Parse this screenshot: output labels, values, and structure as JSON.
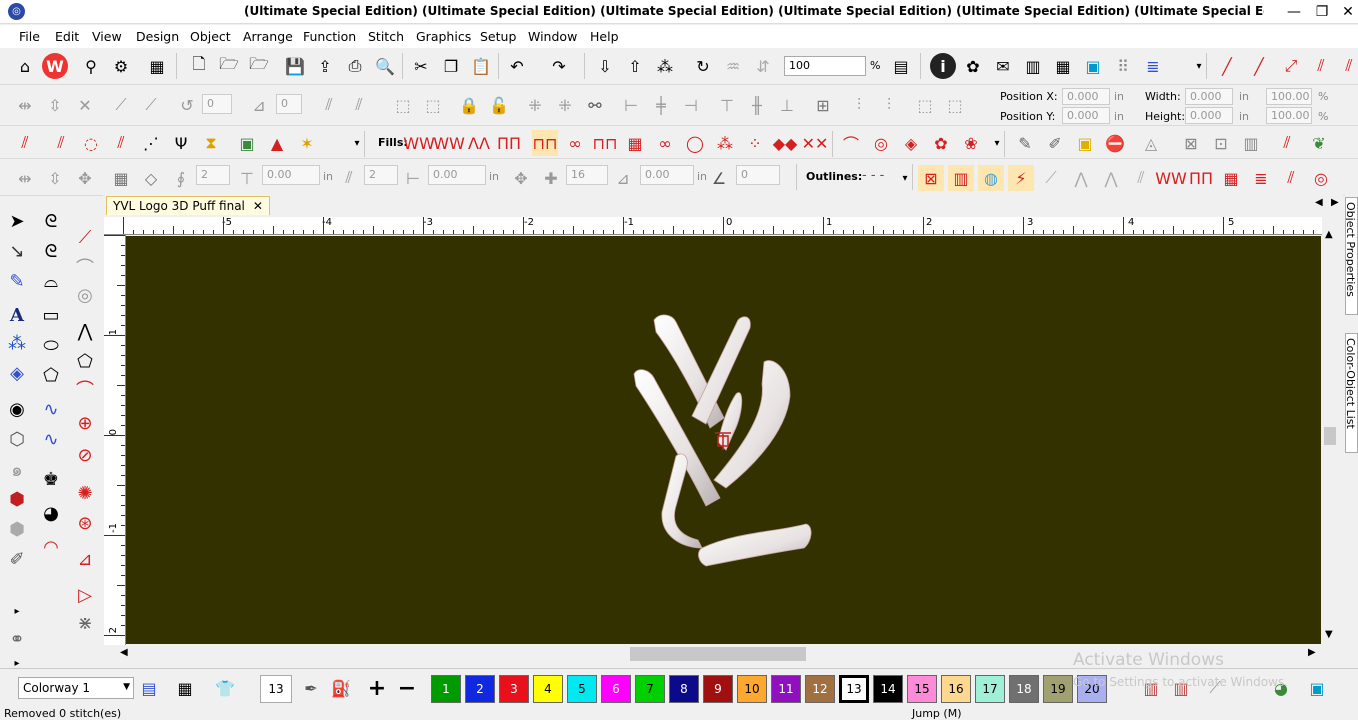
{
  "window": {
    "title": "(Ultimate Special Edition) (Ultimate Special Edition) (Ultimate Special Edition) (Ultimate Special Edition) (Ultimate Special Edition) (Ultimate Special Editi",
    "minimize": "—",
    "restore": "❐",
    "close": "✕"
  },
  "menu": [
    "File",
    "Edit",
    "View",
    "Design",
    "Object",
    "Arrange",
    "Function",
    "Stitch",
    "Graphics",
    "Setup",
    "Window",
    "Help"
  ],
  "toolbar1": {
    "zoom_value": "100",
    "zoom_unit": "%"
  },
  "toolbar2": {
    "rotate_value": "0",
    "slant_value": "0",
    "position_x_label": "Position X:",
    "position_y_label": "Position Y:",
    "position_x": "0.000",
    "position_y": "0.000",
    "pos_unit": "in",
    "width_label": "Width:",
    "height_label": "Height:",
    "width": "0.000",
    "height": "0.000",
    "size_unit": "in",
    "width_pct": "100.00",
    "height_pct": "100.00",
    "pct_unit": "%"
  },
  "toolbar3": {
    "fills_label": "Fills:"
  },
  "toolbar4": {
    "val1": "2",
    "val2": "0.00",
    "unit_in": "in",
    "val3": "2",
    "val4": "0.00",
    "val5": "16",
    "val6": "0.00",
    "val7": "0",
    "outlines_label": "Outlines:"
  },
  "document": {
    "tab_name": "YVL Logo 3D Puff final",
    "tab_close": "✕"
  },
  "ruler": {
    "h_labels": [
      "-5",
      "-4",
      "-3",
      "-2",
      "-1",
      "0",
      "1",
      "2",
      "3",
      "4",
      "5"
    ],
    "v_labels": [
      "-1",
      "0",
      "1",
      "2"
    ]
  },
  "right_panel": {
    "tab1": "Object Properties",
    "tab2": "Color-Object List"
  },
  "colorbar": {
    "colorway": "Colorway 1",
    "current_color": "13",
    "swatches": [
      {
        "n": "1",
        "c": "#009b00",
        "t": "#fff"
      },
      {
        "n": "2",
        "c": "#1028e0",
        "t": "#fff"
      },
      {
        "n": "3",
        "c": "#e8101a",
        "t": "#fff"
      },
      {
        "n": "4",
        "c": "#ffff00",
        "t": "#000"
      },
      {
        "n": "5",
        "c": "#00e8f0",
        "t": "#000"
      },
      {
        "n": "6",
        "c": "#ff00ff",
        "t": "#fff"
      },
      {
        "n": "7",
        "c": "#00d000",
        "t": "#000"
      },
      {
        "n": "8",
        "c": "#0a0a8a",
        "t": "#fff"
      },
      {
        "n": "9",
        "c": "#a01010",
        "t": "#fff"
      },
      {
        "n": "10",
        "c": "#ffa830",
        "t": "#000"
      },
      {
        "n": "11",
        "c": "#9010c0",
        "t": "#fff"
      },
      {
        "n": "12",
        "c": "#a07040",
        "t": "#fff"
      },
      {
        "n": "13",
        "c": "#ffffff",
        "t": "#000"
      },
      {
        "n": "14",
        "c": "#000000",
        "t": "#fff"
      },
      {
        "n": "15",
        "c": "#ff8ad8",
        "t": "#000"
      },
      {
        "n": "16",
        "c": "#ffd890",
        "t": "#000"
      },
      {
        "n": "17",
        "c": "#a0f0d8",
        "t": "#000"
      },
      {
        "n": "18",
        "c": "#707070",
        "t": "#fff"
      },
      {
        "n": "19",
        "c": "#a0a070",
        "t": "#000"
      },
      {
        "n": "20",
        "c": "#a8b0f0",
        "t": "#000"
      }
    ]
  },
  "watermark": {
    "line1": "Activate Windows",
    "line2": "Go to Settings to activate Windows."
  },
  "status": {
    "left": "Removed 0 stitch(es)",
    "mid": "Jump (M)"
  },
  "colors": {
    "canvas": "#333100",
    "accent_red": "#d42020"
  }
}
